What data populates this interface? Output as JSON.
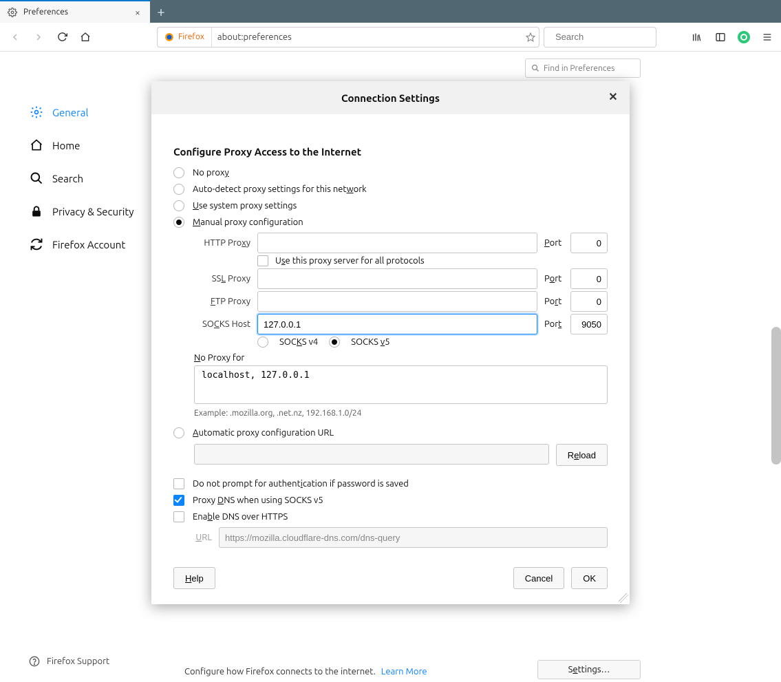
{
  "tab": {
    "title": "Preferences"
  },
  "urlbar": {
    "identity": "Firefox",
    "url": "about:preferences"
  },
  "searchbar": {
    "placeholder": "Search"
  },
  "findpref": {
    "placeholder": "Find in Preferences"
  },
  "sidebar": {
    "general": "General",
    "home": "Home",
    "search": "Search",
    "privacy": "Privacy & Security",
    "account": "Firefox Account"
  },
  "support": "Firefox Support",
  "bottom": {
    "desc": "Configure how Firefox connects to the internet.",
    "learn": "Learn More",
    "settings": "Settings…"
  },
  "modal": {
    "title": "Connection Settings",
    "section": "Configure Proxy Access to the Internet",
    "radios": {
      "none": "No proxy",
      "auto": "Auto-detect proxy settings for this network",
      "system": "Use system proxy settings",
      "manual": "Manual proxy configuration",
      "pac": "Automatic proxy configuration URL"
    },
    "http_label": "HTTP Proxy",
    "http_host": "",
    "http_port": "0",
    "port_label": "Port",
    "use_all": "Use this proxy server for all protocols",
    "ssl_label": "SSL Proxy",
    "ssl_host": "",
    "ssl_port": "0",
    "ftp_label": "FTP Proxy",
    "ftp_host": "",
    "ftp_port": "0",
    "socks_label": "SOCKS Host",
    "socks_host": "127.0.0.1",
    "socks_port": "9050",
    "socks4": "SOCKS v4",
    "socks5": "SOCKS v5",
    "noproxy_label": "No Proxy for",
    "noproxy_val": "localhost, 127.0.0.1",
    "example": "Example: .mozilla.org, .net.nz, 192.168.1.0/24",
    "reload": "Reload",
    "noauth": "Do not prompt for authentication if password is saved",
    "proxydns": "Proxy DNS when using SOCKS v5",
    "doh": "Enable DNS over HTTPS",
    "url_label": "URL",
    "doh_url": "https://mozilla.cloudflare-dns.com/dns-query",
    "help": "Help",
    "cancel": "Cancel",
    "ok": "OK"
  }
}
